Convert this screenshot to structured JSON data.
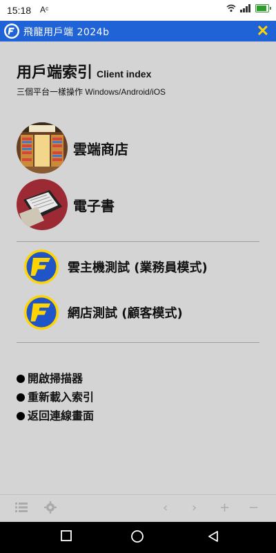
{
  "status": {
    "time": "15:18",
    "extra": "Aᶜ"
  },
  "appbar": {
    "title": "飛龍用戶端  2024b"
  },
  "page": {
    "title": "用戶端索引",
    "title_sub": "Client index",
    "subtitle": "三個平台一樣操作 Windows/Android/iOS"
  },
  "menu": [
    {
      "label": "雲端商店"
    },
    {
      "label": "電子書"
    }
  ],
  "tests": [
    {
      "label": "雲主機測試 (業務員模式)"
    },
    {
      "label": "網店測試 (顧客模式)"
    }
  ],
  "links": [
    {
      "label": "開啟掃描器"
    },
    {
      "label": "重新載入索引"
    },
    {
      "label": "返回連線畫面"
    }
  ],
  "colors": {
    "appbar": "#1f63d6",
    "accent": "#ffd400",
    "content_bg": "#d4d4d4"
  },
  "icons": {
    "bottom": [
      "list-icon",
      "settings-icon",
      "back-icon",
      "forward-icon",
      "zoom-in-icon",
      "zoom-out-icon"
    ],
    "nav": [
      "recents-icon",
      "home-icon",
      "back-icon"
    ]
  }
}
